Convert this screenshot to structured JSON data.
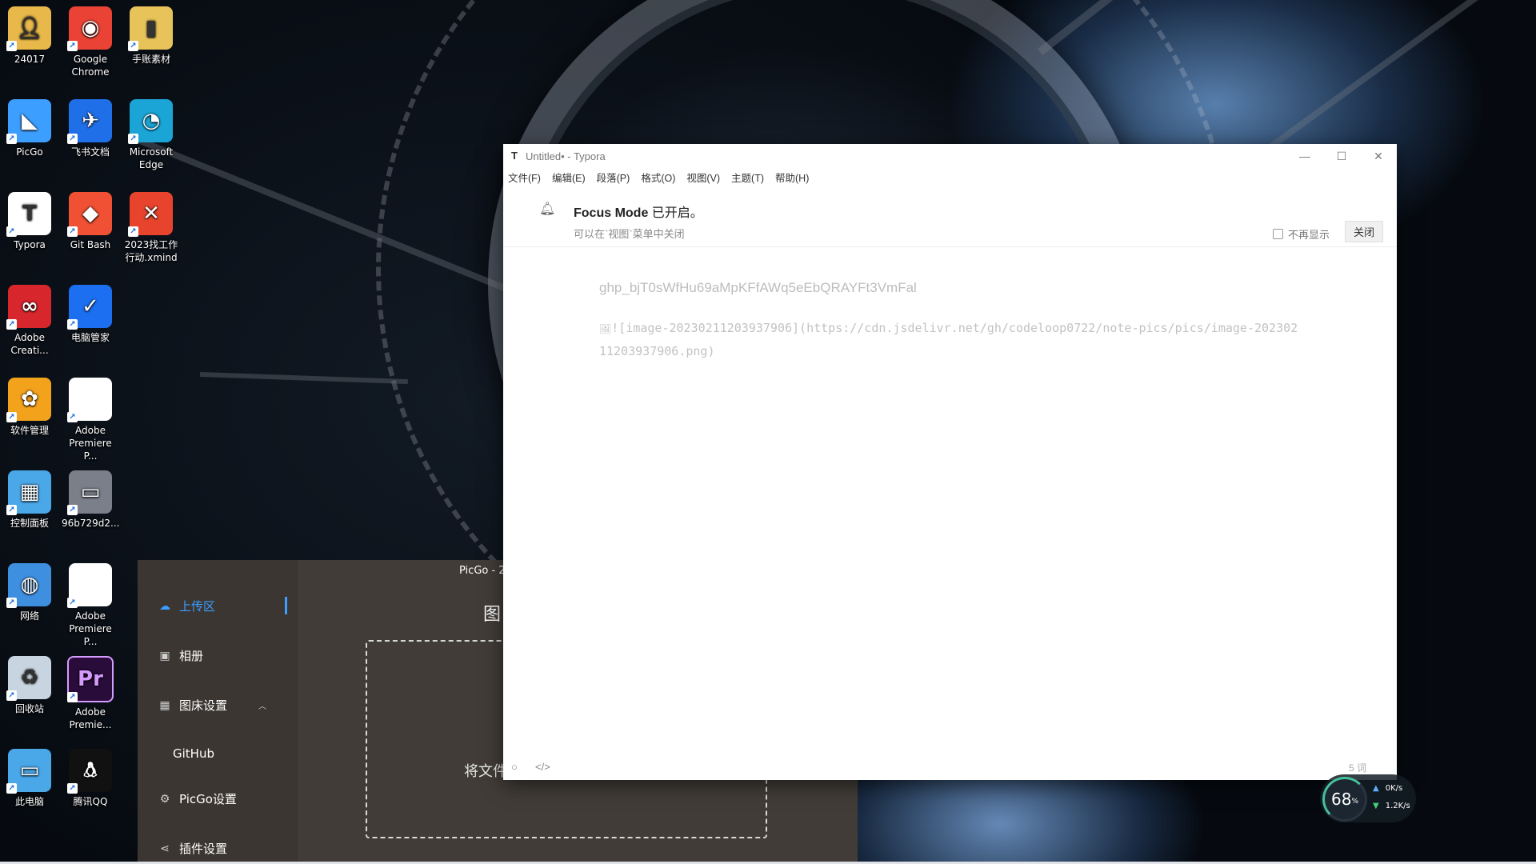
{
  "desktop": {
    "icons": [
      {
        "label": "24017",
        "icon": "user-folder-icon",
        "color": "#e8b84a"
      },
      {
        "label": "Google\nChrome",
        "icon": "chrome-icon",
        "color": "#ea4335"
      },
      {
        "label": "手账素材",
        "icon": "folder-icon",
        "color": "#e8c35a"
      },
      {
        "label": "PicGo",
        "icon": "picgo-icon",
        "color": "#3c9eff"
      },
      {
        "label": "飞书文档",
        "icon": "feishu-icon",
        "color": "#1f6fe8"
      },
      {
        "label": "Microsoft\nEdge",
        "icon": "edge-icon",
        "color": "#1aa5d6"
      },
      {
        "label": "Typora",
        "icon": "typora-icon",
        "color": "#ffffff"
      },
      {
        "label": "Git Bash",
        "icon": "git-icon",
        "color": "#f05033"
      },
      {
        "label": "2023找工作\n行动.xmind",
        "icon": "xmind-icon",
        "color": "#e8442d"
      },
      {
        "label": "Adobe\nCreati...",
        "icon": "adobe-cc-icon",
        "color": "#d8262d"
      },
      {
        "label": "电脑管家",
        "icon": "pc-manager-icon",
        "color": "#1b6ff0"
      },
      {
        "label": "软件管理",
        "icon": "software-manager-icon",
        "color": "#f3a21c"
      },
      {
        "label": "Adobe\nPremiere P...",
        "icon": "document-icon",
        "color": "#ffffff"
      },
      {
        "label": "控制面板",
        "icon": "control-panel-icon",
        "color": "#4aa7e8"
      },
      {
        "label": "96b729d2...",
        "icon": "image-file-icon",
        "color": "#7a7f8a"
      },
      {
        "label": "网络",
        "icon": "network-icon",
        "color": "#3f8fe0"
      },
      {
        "label": "Adobe\nPremiere P...",
        "icon": "document-icon",
        "color": "#ffffff"
      },
      {
        "label": "回收站",
        "icon": "recycle-bin-icon",
        "color": "#c8d4e0"
      },
      {
        "label": "Adobe\nPremie...",
        "icon": "premiere-icon",
        "color": "#2a0c3a"
      },
      {
        "label": "此电脑",
        "icon": "computer-icon",
        "color": "#4aa7e8"
      },
      {
        "label": "腾讯QQ",
        "icon": "qq-icon",
        "color": "#111111"
      }
    ]
  },
  "picgo": {
    "title": "PicGo - 2",
    "nav": {
      "upload": "上传区",
      "gallery": "相册",
      "pichost_settings": "图床设置",
      "github": "GitHub",
      "picgo_settings": "PicGo设置",
      "plugin_settings": "插件设置"
    },
    "heading": "图",
    "drop_text": "将文件"
  },
  "typora": {
    "title": "Untitled• - Typora",
    "menu": [
      "文件(F)",
      "编辑(E)",
      "段落(P)",
      "格式(O)",
      "视图(V)",
      "主题(T)",
      "帮助(H)"
    ],
    "banner": {
      "title_bold": "Focus Mode",
      "title_rest": " 已开启。",
      "subtitle": "可以在`视图`菜单中关闭",
      "dont_show": "不再显示",
      "close": "关闭"
    },
    "content": {
      "token": "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",
      "image_markdown": "![image-20230211203937906](https://cdn.jsdelivr.net/gh/codeloop0722/note-pics/pics/image-20230211203937906.png)"
    },
    "footer": {
      "word_count": "5 词"
    }
  },
  "netmon": {
    "percent": "68",
    "percent_unit": "%",
    "up": "0K/s",
    "down": "1.2K/s"
  }
}
